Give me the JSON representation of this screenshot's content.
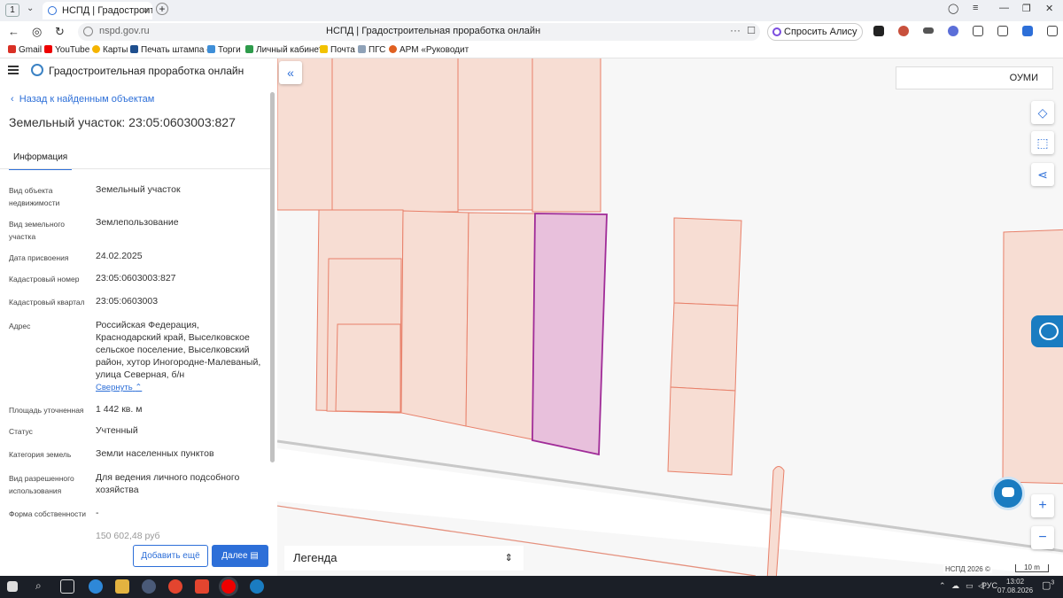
{
  "browser": {
    "tab_count": "1",
    "tab_title": "НСПД | Градостроитель",
    "url": "nspd.gov.ru",
    "page_title": "НСПД | Градостроительная проработка онлайн",
    "alice_label": "Спросить Алису AI",
    "bookmarks": [
      "Gmail",
      "YouTube",
      "Карты",
      "Печать штампа с",
      "Торги",
      "Личный кабинет",
      "Почта",
      "ПГС",
      "АРМ «Руководит"
    ]
  },
  "panel": {
    "app_title": "Градостроительная проработка онлайн",
    "back_label": "Назад к найденным объектам",
    "object_title": "Земельный участок: 23:05:0603003:827",
    "tab_label": "Информация",
    "fields": [
      {
        "label": "Вид объекта недвижимости",
        "value": "Земельный участок"
      },
      {
        "label": "Вид земельного участка",
        "value": "Землепользование"
      },
      {
        "label": "Дата присвоения",
        "value": "24.02.2025"
      },
      {
        "label": "Кадастровый номер",
        "value": "23:05:0603003:827"
      },
      {
        "label": "Кадастровый квартал",
        "value": "23:05:0603003"
      },
      {
        "label": "Адрес",
        "value": "Российская Федерация, Краснодарский край, Выселковское сельское поселение, Выселковский район, хутор Иногородне-Малеваный, улица Северная, б/н"
      },
      {
        "label": "Площадь уточненная",
        "value": "1 442 кв. м"
      },
      {
        "label": "Статус",
        "value": "Учтенный"
      },
      {
        "label": "Категория земель",
        "value": "Земли населенных пунктов"
      },
      {
        "label": "Вид разрешенного использования",
        "value": "Для ведения личного подсобного хозяйства"
      },
      {
        "label": "Форма собственности",
        "value": "-"
      }
    ],
    "partial_value": "150 602,48 руб",
    "collapse_label": "Свернуть",
    "add_more_label": "Добавить ещё",
    "next_label": "Далее"
  },
  "map": {
    "layer_selected": "ОУМИ",
    "legend_label": "Легенда",
    "copyright": "НСПД 2026 ©",
    "scale_label": "10 m",
    "zoom_in": "+",
    "zoom_out": "−",
    "collapse_icon": "«",
    "parcel_fill": "#e8c0dc",
    "parcel_stroke": "#a02c98",
    "other_fill": "#f7ddd3",
    "other_stroke": "#e8806a"
  },
  "taskbar": {
    "lang": "РУС",
    "time": "13:02",
    "date": "07.08.2026",
    "notifications": "3"
  }
}
